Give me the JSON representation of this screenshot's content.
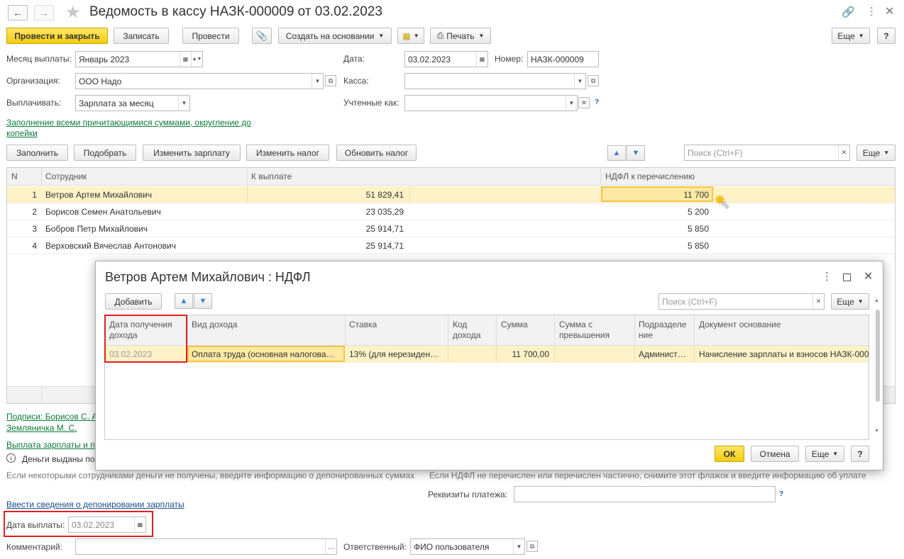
{
  "window": {
    "title": "Ведомость в кассу НАЗК-000009 от 03.02.2023",
    "more_label": "Еще",
    "help_label": "?"
  },
  "toolbar": {
    "post_close": "Провести и закрыть",
    "save": "Записать",
    "post": "Провести",
    "create_based": "Создать на основании",
    "print": "Печать",
    "more": "Еще"
  },
  "form": {
    "month_label": "Месяц выплаты:",
    "month_value": "Январь 2023",
    "date_label": "Дата:",
    "date_value": "03.02.2023",
    "number_label": "Номер:",
    "number_value": "НАЗК-000009",
    "org_label": "Организация:",
    "org_value": "ООО Надо",
    "kassa_label": "Касса:",
    "kassa_value": "",
    "pay_label": "Выплачивать:",
    "pay_value": "Зарплата за месяц",
    "counted_label": "Учтенные как:",
    "counted_value": "",
    "fill_link": "Заполнение всеми причитающимися суммами, округление до",
    "fill_link_2": "копейки"
  },
  "table_toolbar": {
    "fill": "Заполнить",
    "pick": "Подобрать",
    "change_salary": "Изменить зарплату",
    "change_tax": "Изменить налог",
    "refresh_tax": "Обновить налог",
    "search_placeholder": "Поиск (Ctrl+F)",
    "more": "Еще"
  },
  "main_table": {
    "columns": [
      "N",
      "Сотрудник",
      "К выплате",
      "НДФЛ к перечислению"
    ],
    "rows": [
      {
        "n": "1",
        "employee": "Ветров Артем Михайлович",
        "pay": "51 829,41",
        "ndfl": "11 700"
      },
      {
        "n": "2",
        "employee": "Борисов Семен Анатольевич",
        "pay": "23 035,29",
        "ndfl": "5 200"
      },
      {
        "n": "3",
        "employee": "Бобров Петр Михайлович",
        "pay": "25 914,71",
        "ndfl": "5 850"
      },
      {
        "n": "4",
        "employee": "Верховский Вячеслав Антонович",
        "pay": "25 914,71",
        "ndfl": "5 850"
      }
    ]
  },
  "lower": {
    "signatures_link_1": "Подписи: Борисов С. А.",
    "signatures_link_2": "Земляничка М. С.",
    "payout_link": "Выплата зарплаты и п",
    "money_info": "Деньги выданы по",
    "hint_left": "Если некоторыми сотрудниками деньги не получены, введите информацию о депонированных суммах",
    "hint_right": "Если НДФЛ не перечислен или перечислен частично, снимите этот флажок и введите информацию об уплате",
    "payment_details_label": "Реквизиты платежа:",
    "deposit_link": "Ввести сведения о депонировании зарплаты",
    "pay_date_label": "Дата выплаты:",
    "pay_date_value": "03.02.2023",
    "comment_label": "Комментарий:",
    "responsible_label": "Ответственный:",
    "responsible_value": "ФИО пользователя"
  },
  "dialog": {
    "title": "Ветров Артем Михайлович : НДФЛ",
    "add": "Добавить",
    "search_placeholder": "Поиск (Ctrl+F)",
    "more": "Еще",
    "columns": [
      "Дата получения дохода",
      "Вид дохода",
      "Ставка",
      "Код дохода",
      "Сумма",
      "Сумма с превышения",
      "Подразделение",
      "Документ основание"
    ],
    "col_lines": [
      [
        "Дата получения",
        "дохода"
      ],
      [
        "Вид дохода"
      ],
      [
        "Ставка"
      ],
      [
        "Код",
        "дохода"
      ],
      [
        "Сумма"
      ],
      [
        "Сумма с",
        "превышения"
      ],
      [
        "Подразделе",
        "ние"
      ],
      [
        "Документ основание"
      ]
    ],
    "row": {
      "date": "03.02.2023",
      "kind": "Оплата труда (основная налогова…",
      "rate": "13% (для нерезиден…",
      "code": "",
      "sum": "11 700,00",
      "excess": "",
      "dept": "Админист…",
      "doc": "Начисление зарплаты и взносов НАЗК-000"
    },
    "ok": "ОК",
    "cancel": "Отмена",
    "more_bottom": "Еще",
    "help": "?"
  },
  "colors": {
    "accent": "#f2cb10",
    "highlight_row": "#fdf2c8",
    "red_frame": "#e02020",
    "link": "#0c7a3a"
  }
}
